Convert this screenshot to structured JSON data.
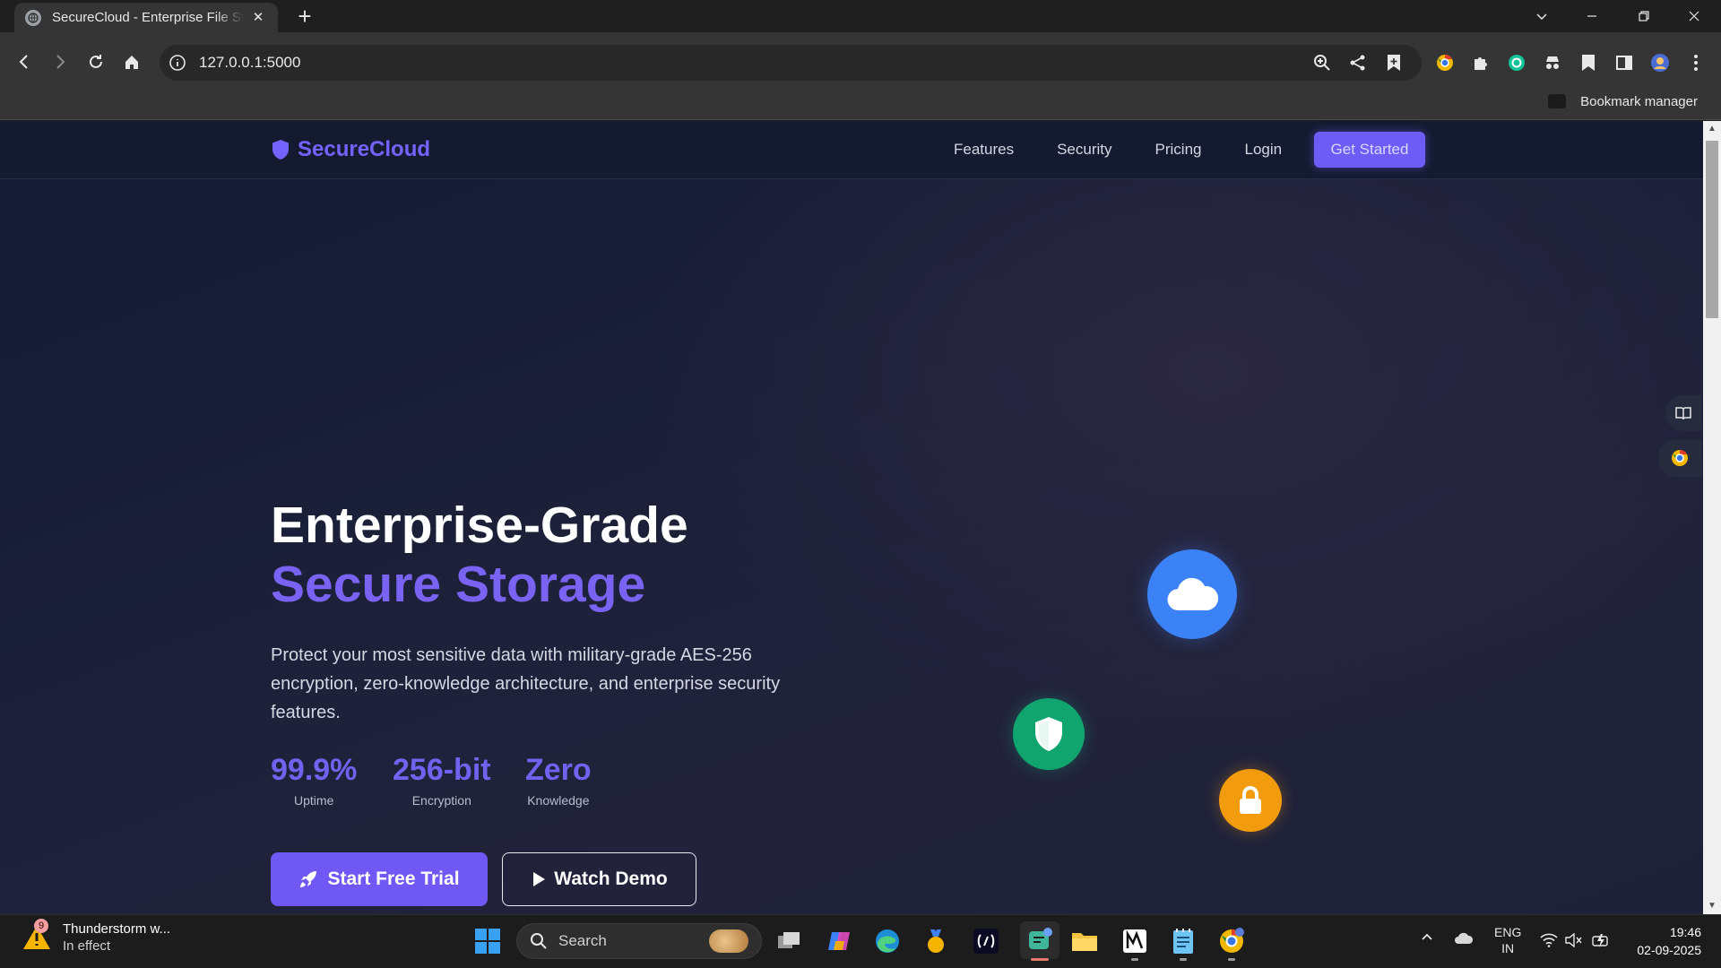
{
  "browser": {
    "tab_title": "SecureCloud - Enterprise File Storage",
    "url": "127.0.0.1:5000",
    "bookmark_manager_label": "Bookmark manager"
  },
  "site": {
    "brand": "SecureCloud",
    "nav": {
      "features": "Features",
      "security": "Security",
      "pricing": "Pricing",
      "login": "Login",
      "get_started": "Get Started"
    },
    "hero": {
      "title_line1": "Enterprise-Grade",
      "title_line2": "Secure Storage",
      "description": "Protect your most sensitive data with military-grade AES-256 encryption, zero-knowledge architecture, and enterprise security features.",
      "stats": [
        {
          "value": "99.9%",
          "label": "Uptime"
        },
        {
          "value": "256-bit",
          "label": "Encryption"
        },
        {
          "value": "Zero",
          "label": "Knowledge"
        }
      ],
      "primary_cta": "Start Free Trial",
      "secondary_cta": "Watch Demo"
    },
    "colors": {
      "accent": "#7058f4",
      "cloud_icon": "#3b82f6",
      "shield_icon": "#10a56f",
      "lock_icon": "#f29b0c"
    }
  },
  "taskbar": {
    "weather_badge": "9",
    "weather_title": "Thunderstorm w...",
    "weather_status": "In effect",
    "search_placeholder": "Search",
    "language_line1": "ENG",
    "language_line2": "IN",
    "time": "19:46",
    "date": "02-09-2025"
  }
}
